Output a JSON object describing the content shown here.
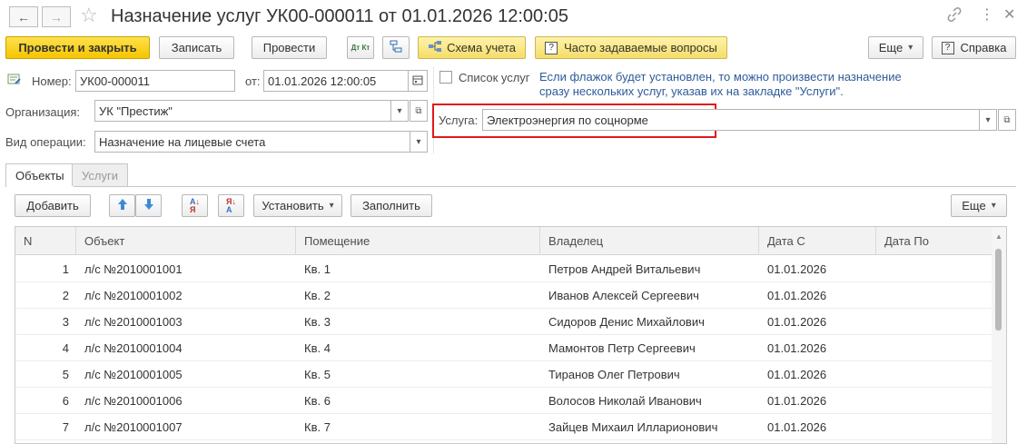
{
  "window": {
    "title": "Назначение услуг УК00-000011 от 01.01.2026 12:00:05",
    "back_icon": "arrow-left-icon",
    "forward_icon": "arrow-right-icon",
    "favorite_icon": "star-icon",
    "link_icon": "link-icon",
    "menu_icon": "more-vertical-icon",
    "close_icon": "close-icon"
  },
  "toolbar": {
    "post_close": "Провести и закрыть",
    "save": "Записать",
    "post": "Провести",
    "dtkt_icon": "Дт Кт",
    "accounting_scheme": "Схема учета",
    "faq": "Часто задаваемые вопросы",
    "faq_icon": "?",
    "more": "Еще",
    "help_icon": "?",
    "help": "Справка"
  },
  "form": {
    "number_label": "Номер:",
    "number_value": "УК00-000011",
    "date_label": "от:",
    "date_value": "01.01.2026 12:00:05",
    "services_list_label": "Список услуг",
    "services_list_checked": false,
    "hint_line1": "Если флажок будет установлен, то можно произвести назначение",
    "hint_line2": "сразу нескольких услуг, указав их на закладке \"Услуги\".",
    "org_label": "Организация:",
    "org_value": "УК \"Престиж\"",
    "service_label": "Услуга:",
    "service_value": "Электроэнергия по соцнорме",
    "operation_label": "Вид операции:",
    "operation_value": "Назначение на лицевые счета",
    "highlight_color": "#e0191b"
  },
  "tabs": [
    {
      "label": "Объекты",
      "active": true
    },
    {
      "label": "Услуги",
      "active": false
    }
  ],
  "table_toolbar": {
    "add": "Добавить",
    "set": "Установить",
    "fill": "Заполнить",
    "more": "Еще"
  },
  "table": {
    "columns": [
      "N",
      "Объект",
      "Помещение",
      "Владелец",
      "Дата С",
      "Дата По"
    ],
    "rows": [
      {
        "n": "1",
        "object": "л/с №2010001001",
        "room": "Кв. 1",
        "owner": "Петров Андрей Витальевич",
        "date_from": "01.01.2026",
        "date_to": ""
      },
      {
        "n": "2",
        "object": "л/с №2010001002",
        "room": "Кв. 2",
        "owner": "Иванов Алексей Сергеевич",
        "date_from": "01.01.2026",
        "date_to": ""
      },
      {
        "n": "3",
        "object": "л/с №2010001003",
        "room": "Кв. 3",
        "owner": "Сидоров Денис Михайлович",
        "date_from": "01.01.2026",
        "date_to": ""
      },
      {
        "n": "4",
        "object": "л/с №2010001004",
        "room": "Кв. 4",
        "owner": "Мамонтов Петр Сергеевич",
        "date_from": "01.01.2026",
        "date_to": ""
      },
      {
        "n": "5",
        "object": "л/с №2010001005",
        "room": "Кв. 5",
        "owner": "Тиранов Олег Петрович",
        "date_from": "01.01.2026",
        "date_to": ""
      },
      {
        "n": "6",
        "object": "л/с №2010001006",
        "room": "Кв. 6",
        "owner": "Волосов Николай Иванович",
        "date_from": "01.01.2026",
        "date_to": ""
      },
      {
        "n": "7",
        "object": "л/с №2010001007",
        "room": "Кв. 7",
        "owner": "Зайцев Михаил Илларионович",
        "date_from": "01.01.2026",
        "date_to": ""
      }
    ]
  }
}
